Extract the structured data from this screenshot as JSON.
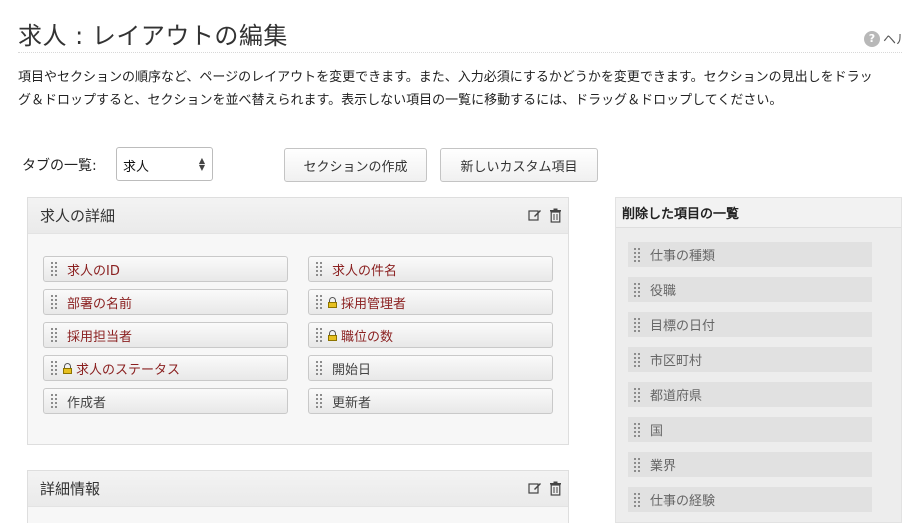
{
  "page": {
    "title": "求人 : レイアウトの編集",
    "help_label": "ヘルプ",
    "help_icon_text": "?"
  },
  "description": {
    "line1": "項目やセクションの順序など、ページのレイアウトを変更できます。また、入力必須にするかどうかを変更できます。セクションの見出しをドラッ",
    "line2": "グ＆ドロップすると、セクションを並べ替えられます。表示しない項目の一覧に移動するには、ドラッグ＆ドロップしてください。"
  },
  "toolbar": {
    "tabs_label": "タブの一覧:",
    "tab_selected": "求人",
    "create_section_label": "セクションの作成",
    "new_custom_field_label": "新しいカスタム項目"
  },
  "sections": [
    {
      "title": "求人の詳細",
      "fields": [
        {
          "label": "求人のID",
          "locked": false,
          "style": "required"
        },
        {
          "label": "求人の件名",
          "locked": false,
          "style": "required"
        },
        {
          "label": "部署の名前",
          "locked": false,
          "style": "required"
        },
        {
          "label": "採用管理者",
          "locked": true,
          "style": "required"
        },
        {
          "label": "採用担当者",
          "locked": false,
          "style": "required"
        },
        {
          "label": "職位の数",
          "locked": true,
          "style": "required"
        },
        {
          "label": "求人のステータス",
          "locked": true,
          "style": "required"
        },
        {
          "label": "開始日",
          "locked": false,
          "style": "plain"
        },
        {
          "label": "作成者",
          "locked": false,
          "style": "plain"
        },
        {
          "label": "更新者",
          "locked": false,
          "style": "plain"
        }
      ]
    },
    {
      "title": "詳細情報",
      "fields": []
    }
  ],
  "deleted_panel": {
    "title": "削除した項目の一覧",
    "items": [
      "仕事の種類",
      "役職",
      "目標の日付",
      "市区町村",
      "都道府県",
      "国",
      "業界",
      "仕事の経験"
    ]
  },
  "icons": {
    "edit": "edit-icon",
    "delete": "trash-icon",
    "drag": "drag-handle-icon",
    "lock": "lock-icon",
    "help": "help-icon"
  },
  "colors": {
    "required_text": "#8a1f1f",
    "plain_text": "#444444",
    "lock_body": "#e7c020"
  }
}
